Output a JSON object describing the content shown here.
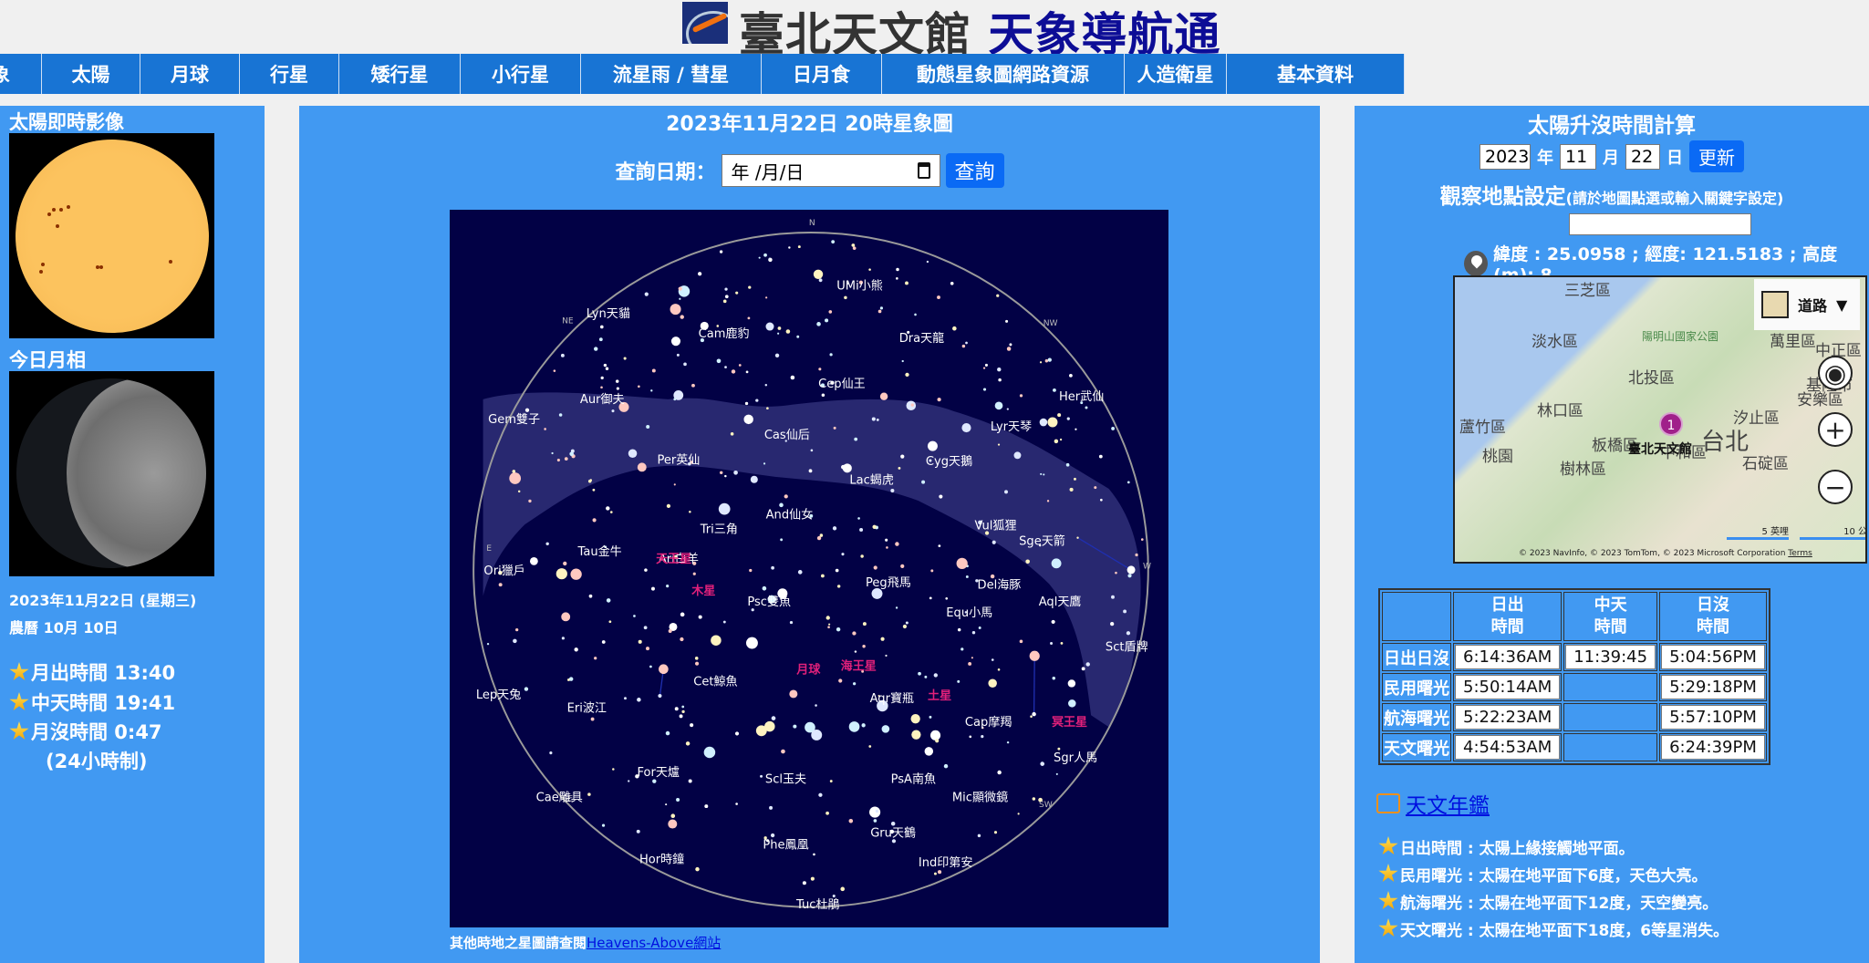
{
  "header": {
    "title_a": "臺北天文館",
    "title_b": "天象導航通"
  },
  "nav": [
    "象",
    "太陽",
    "月球",
    "行星",
    "矮行星",
    "小行星",
    "流星雨 / 彗星",
    "日月食",
    "動態星象圖網路資源",
    "人造衛星",
    "基本資料"
  ],
  "left": {
    "sun_heading": "太陽即時影像",
    "moon_heading": "今日月相",
    "date": "2023年11月22日 (星期三)",
    "lunar": "農曆 10月 10日",
    "moonrise": "月出時間 13:40",
    "transit": "中天時間 19:41",
    "moonset": "月沒時間 0:47",
    "note": "(24小時制)"
  },
  "center": {
    "title": "2023年11月22日 20時星象圖",
    "query_label": "查詢日期：",
    "date_placeholder": "年 /月/日",
    "query_button": "查詢",
    "footer_text": "其他時地之星圖請查閱",
    "footer_link": "Heavens-Above網站"
  },
  "chart_data": {
    "type": "sky-map",
    "directions": [
      "N",
      "NE",
      "NW",
      "E",
      "W",
      "SE",
      "SW"
    ],
    "constellations": [
      "UMi小熊",
      "Lyn天貓",
      "Cam鹿豹",
      "Dra天龍",
      "Her武仙",
      "Cep仙王",
      "Aur御夫",
      "Gem雙子",
      "Cas仙后",
      "Lyr天琴",
      "Per英仙",
      "Cyg天鵝",
      "Lac蝎虎",
      "And仙女",
      "Tri三角",
      "Vul狐狸",
      "Sge天箭",
      "Ori獵戶",
      "Tau金牛",
      "Ari白羊",
      "Peg飛馬",
      "Del海豚",
      "Aql天鷹",
      "Psc雙魚",
      "Equ小馬",
      "Sct盾牌",
      "Cet鯨魚",
      "Lep天兔",
      "Eri波江",
      "Aqr寶瓶",
      "Cap摩羯",
      "Sgr人馬",
      "For天爐",
      "Scl玉夫",
      "PsA南魚",
      "Cae雕具",
      "Mic顯微鏡",
      "Gru天鶴",
      "Phe鳳凰",
      "Hor時鐘",
      "Ind印第安",
      "Tuc杜鵑"
    ],
    "planets": [
      "天王星",
      "木星",
      "月球",
      "海王星",
      "土星",
      "冥王星"
    ],
    "planet_color": "#e0207a"
  },
  "right": {
    "title": "太陽升沒時間計算",
    "year": "2023",
    "year_unit": "年",
    "month": "11",
    "month_unit": "月",
    "day": "22",
    "day_unit": "日",
    "update_button": "更新",
    "loc_title": "觀察地點設定",
    "loc_hint": "(請於地圖點選或輸入關鍵字設定)",
    "loc_input": "",
    "coords": "緯度 : 25.0958 ; 經度: 121.5183 ; 高度(m): 8",
    "map": {
      "type_label": "道路",
      "marker": "1",
      "marker_label": "臺北天文館",
      "scale_mi": "5 英哩",
      "scale_km": "10 公里",
      "copyright": "© 2023 NavInfo, © 2023 TomTom, © 2023 Microsoft Corporation",
      "terms": "Terms",
      "places": [
        "三芝區",
        "淡水區",
        "陽明山國家公園",
        "萬里區",
        "北投區",
        "林口區",
        "蘆竹區",
        "台北",
        "汐止區",
        "板橋區",
        "中和區",
        "桃園",
        "樹林區",
        "石碇區",
        "基隆市",
        "安樂區",
        "中正區"
      ]
    },
    "table": {
      "headers": [
        [
          "日出",
          "時間"
        ],
        [
          "中天",
          "時間"
        ],
        [
          "日沒",
          "時間"
        ]
      ],
      "rows": [
        {
          "label": "日出日沒",
          "rise": "6:14:36AM",
          "transit": "11:39:45",
          "set": "5:04:56PM"
        },
        {
          "label": "民用曙光",
          "rise": "5:50:14AM",
          "transit": "",
          "set": "5:29:18PM"
        },
        {
          "label": "航海曙光",
          "rise": "5:22:23AM",
          "transit": "",
          "set": "5:57:10PM"
        },
        {
          "label": "天文曙光",
          "rise": "4:54:53AM",
          "transit": "",
          "set": "6:24:39PM"
        }
      ]
    },
    "almanac_link": "天文年鑑",
    "notes": [
      "日出時間 : 太陽上緣接觸地平面。",
      "民用曙光 : 太陽在地平面下6度，天色大亮。",
      "航海曙光 : 太陽在地平面下12度，天空變亮。",
      "天文曙光 : 太陽在地平面下18度，6等星消失。"
    ]
  }
}
